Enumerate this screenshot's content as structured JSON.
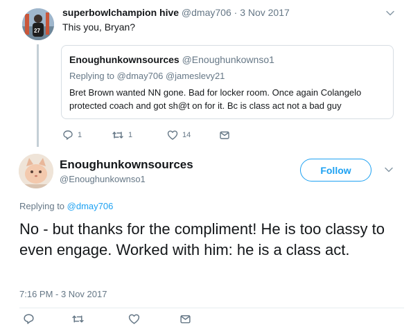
{
  "parent_tweet": {
    "author_name": "superbowlchampion hive",
    "author_handle": "@dmay706",
    "separator": "·",
    "date": "3 Nov 2017",
    "text": "This you, Bryan?",
    "quoted": {
      "author_name": "Enoughunkownsources",
      "author_handle": "@Enoughunkownso1",
      "replying_to_label": "Replying to",
      "replying_to_handles": "@dmay706 @jameslevy21",
      "text": "Bret Brown wanted NN gone. Bad for locker room. Once again Colangelo protected coach and got sh@t on for it. Bc is class act not a bad guy"
    },
    "actions": {
      "reply_count": "1",
      "retweet_count": "1",
      "like_count": "14"
    }
  },
  "main_tweet": {
    "author_name": "Enoughunkownsources",
    "author_handle": "@Enoughunkownso1",
    "follow_label": "Follow",
    "replying_to_label": "Replying to",
    "replying_to_handle": "@dmay706",
    "text": "No - but thanks for the compliment! He is too classy to even engage. Worked with him: he is a class act.",
    "timestamp": "7:16 PM - 3 Nov 2017"
  },
  "colors": {
    "accent": "#1da1f2",
    "secondary_text": "#657786",
    "primary_text": "#14171a",
    "border": "#d6dde3"
  },
  "icons": [
    "reply-icon",
    "retweet-icon",
    "like-icon",
    "direct-message-icon",
    "chevron-down-icon"
  ]
}
